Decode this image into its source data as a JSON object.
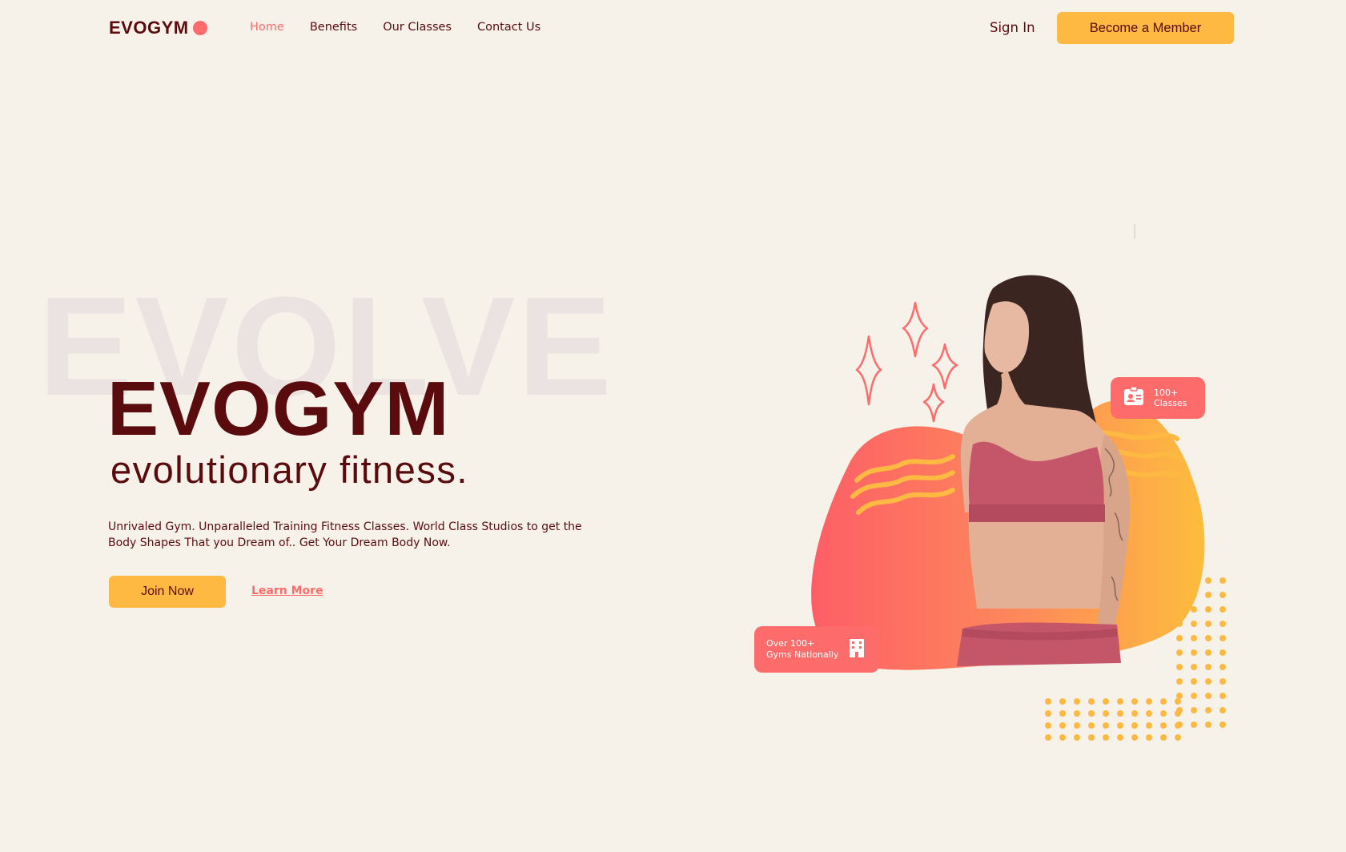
{
  "nav": {
    "logo": "EVOGYM",
    "links": [
      "Home",
      "Benefits",
      "Our Classes",
      "Contact Us"
    ],
    "active": "Home",
    "sign_in": "Sign In",
    "cta": "Become a Member"
  },
  "hero": {
    "background_word": "EVOLVE",
    "title": "EVOGYM",
    "subtitle": "evolutionary fitness.",
    "description": "Unrivaled Gym. Unparalleled Training Fitness Classes. World Class Studios to get the Body Shapes That you Dream of.. Get Your Dream Body Now.",
    "join_button": "Join Now",
    "learn_more": "Learn More"
  },
  "badges": {
    "classes_line1": "100+",
    "classes_line2": "Classes",
    "gyms_line1": "Over 100+",
    "gyms_line2": "Gyms Nationally"
  },
  "colors": {
    "background": "#f6f1e9",
    "primary_text": "#5a0b0e",
    "accent_red": "#fd6b6b",
    "accent_yellow": "#fdb942"
  },
  "icons": [
    "logo-dot-icon",
    "id-card-icon",
    "building-icon",
    "sparkle-icon"
  ]
}
